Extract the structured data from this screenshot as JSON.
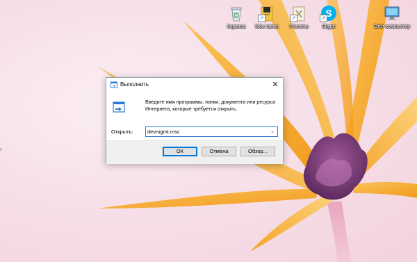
{
  "desktop": {
    "icons": [
      {
        "label": "Корзина",
        "icon": "recycle-bin-icon"
      },
      {
        "label": "Мои папки",
        "icon": "folder-icon"
      },
      {
        "label": "Утилиты",
        "icon": "tools-folder-icon"
      },
      {
        "label": "Skype",
        "icon": "skype-icon"
      },
      {
        "label": "Этот компьютер",
        "icon": "computer-icon"
      }
    ],
    "edge_mark": "›"
  },
  "dialog": {
    "title": "Выполнить",
    "close_glyph": "✕",
    "description": "Введите имя программы, папки, документа или ресурса Интернета, которые требуется открыть.",
    "open_label": "Открыть:",
    "open_value": "devmgmt.msc",
    "dropdown_glyph": "⌄",
    "buttons": {
      "ok": "ОК",
      "cancel": "Отмена",
      "browse": "Обзор..."
    }
  },
  "colors": {
    "accent": "#0078d7",
    "petal": "#f5a623",
    "flower_center": "#7a3a78",
    "wallpaper": "#f6dde6"
  }
}
